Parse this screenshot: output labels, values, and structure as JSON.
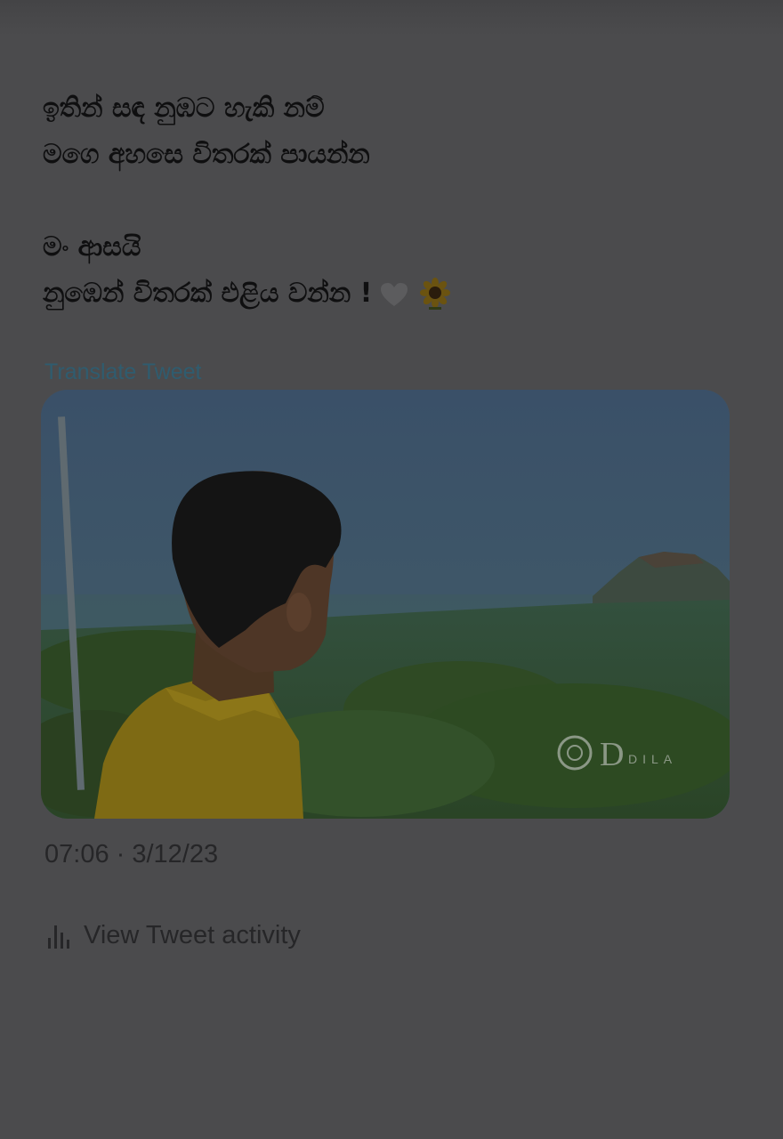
{
  "tweet": {
    "lines": [
      "ඉතින් සඳ නුඹට හැකි නම්",
      "මගෙ අහසෙ විතරක් පායන්න",
      "මං ආසයි",
      "නුඹෙන් විතරක් එළිය වන්න !"
    ],
    "emoji": [
      "white-heart-icon",
      "sunflower-icon"
    ],
    "translate_label": "Translate Tweet",
    "media": {
      "description_icon": "photo",
      "watermark": "DILA"
    },
    "timestamp": "07:06 · 3/12/23",
    "activity_label": "View Tweet activity",
    "activity_icon": "bar-chart-icon"
  },
  "colors": {
    "overlay": "#4b4b4d",
    "link": "#2f5c6f",
    "text": "#0f0f10"
  }
}
